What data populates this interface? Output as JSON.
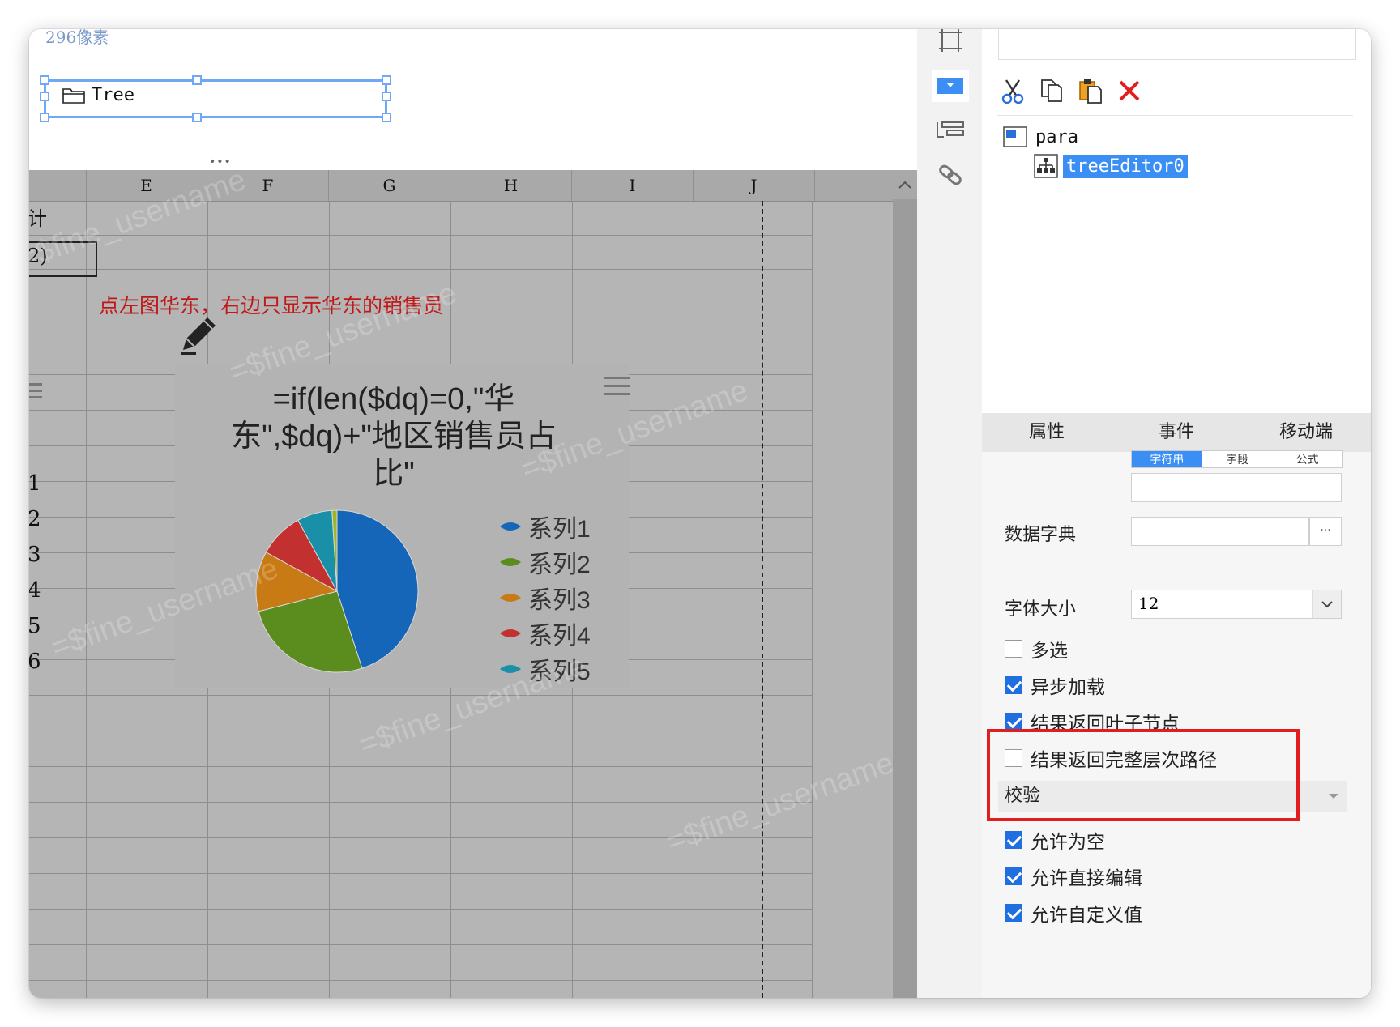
{
  "canvas": {
    "pixel_label": "296像素",
    "tree_widget_label": "Tree"
  },
  "sheet": {
    "columns": [
      "E",
      "F",
      "G",
      "H",
      "I",
      "J"
    ],
    "partial_cells": [
      "计",
      "2)"
    ],
    "row_numbers_partial": [
      "1",
      "2",
      "3",
      "4",
      "5",
      "6"
    ],
    "note": "点左图华东，右边只显示华东的销售员",
    "watermark": "=$fine_username"
  },
  "chart_data": {
    "type": "pie",
    "title": "=if(len($dq)=0,\"华东\",$dq)+\"地区销售员占比\"",
    "legend_position": "right",
    "series": [
      {
        "name": "系列1",
        "value": 45,
        "color": "#1565b8"
      },
      {
        "name": "系列2",
        "value": 26,
        "color": "#5b8c1e"
      },
      {
        "name": "系列3",
        "value": 12,
        "color": "#c87a14"
      },
      {
        "name": "系列4",
        "value": 9,
        "color": "#c23030"
      },
      {
        "name": "系列5",
        "value": 7,
        "color": "#1a8fa8"
      },
      {
        "name": "",
        "value": 1,
        "color": "#9ab824"
      }
    ]
  },
  "toolstrip": {
    "tools": [
      "frame-icon",
      "dropdown-icon",
      "stack-icon",
      "link-icon"
    ]
  },
  "panel": {
    "toolbar": [
      "cut-icon",
      "copy-icon",
      "paste-icon",
      "delete-icon"
    ],
    "tree": {
      "root": "para",
      "child": "treeEditor0"
    },
    "tabs": [
      "属性",
      "事件",
      "移动端"
    ],
    "active_tab": "属性",
    "segment_options": [
      "字符串",
      "字段",
      "公式"
    ],
    "data_dict_label": "数据字典",
    "font_size_label": "字体大小",
    "font_size_value": "12",
    "checkboxes": [
      {
        "label": "多选",
        "checked": false
      },
      {
        "label": "异步加载",
        "checked": true
      },
      {
        "label": "结果返回叶子节点",
        "checked": true
      },
      {
        "label": "结果返回完整层次路径",
        "checked": false
      }
    ],
    "validation_section": "校验",
    "validation_checkboxes": [
      {
        "label": "允许为空",
        "checked": true
      },
      {
        "label": "允许直接编辑",
        "checked": true
      },
      {
        "label": "允许自定义值",
        "checked": true
      }
    ],
    "ellipsis": "···"
  },
  "colors": {
    "highlight_red": "#e11d1d",
    "accent_blue": "#3b8ff4",
    "note_red": "#c01818"
  }
}
